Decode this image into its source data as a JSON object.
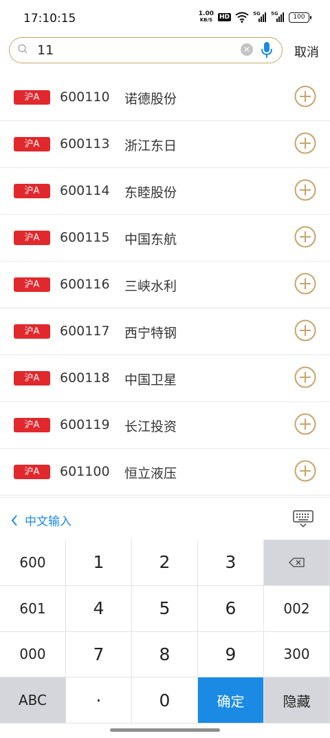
{
  "status_bar": {
    "time": "17:10:15",
    "net_speed_value": "1.00",
    "net_speed_unit": "KB/S",
    "hd_label": "HD",
    "signal1_label": "5G",
    "signal2_label": "5G",
    "battery": "100"
  },
  "search": {
    "value": "11",
    "cancel_label": "取消"
  },
  "results": [
    {
      "market": "沪A",
      "code": "600110",
      "name": "诺德股份"
    },
    {
      "market": "沪A",
      "code": "600113",
      "name": "浙江东日"
    },
    {
      "market": "沪A",
      "code": "600114",
      "name": "东睦股份"
    },
    {
      "market": "沪A",
      "code": "600115",
      "name": "中国东航"
    },
    {
      "market": "沪A",
      "code": "600116",
      "name": "三峡水利"
    },
    {
      "market": "沪A",
      "code": "600117",
      "name": "西宁特钢"
    },
    {
      "market": "沪A",
      "code": "600118",
      "name": "中国卫星"
    },
    {
      "market": "沪A",
      "code": "600119",
      "name": "长江投资"
    },
    {
      "market": "沪A",
      "code": "601100",
      "name": "恒立液压"
    }
  ],
  "keyboard": {
    "mode_label": "中文输入",
    "keys": [
      "600",
      "1",
      "2",
      "3",
      "⌫",
      "601",
      "4",
      "5",
      "6",
      "002",
      "000",
      "7",
      "8",
      "9",
      "300",
      "ABC",
      "·",
      "0",
      "确定",
      "隐藏"
    ]
  },
  "colors": {
    "accent_gold": "#c9a36a",
    "market_badge": "#e0282d",
    "confirm_blue": "#1a8ae5"
  }
}
